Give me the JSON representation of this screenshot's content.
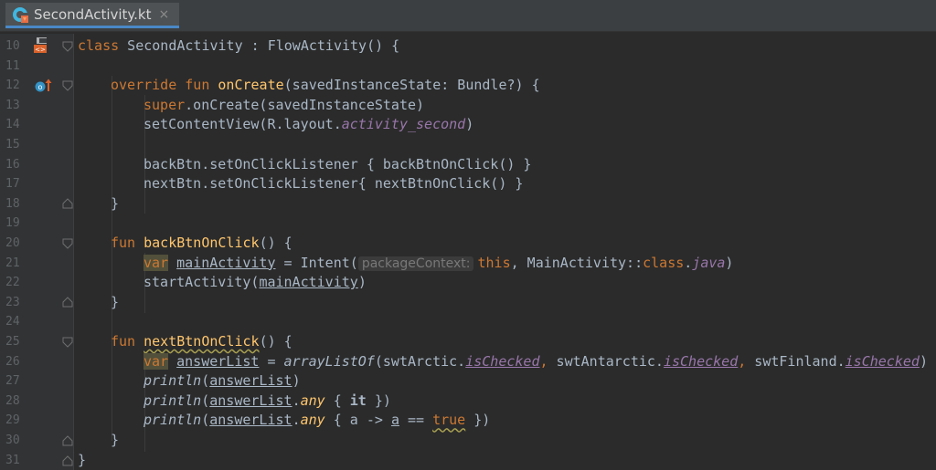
{
  "tab": {
    "title": "SecondActivity.kt",
    "close": "×"
  },
  "line_numbers": [
    "10",
    "11",
    "12",
    "13",
    "14",
    "15",
    "16",
    "17",
    "18",
    "19",
    "20",
    "21",
    "22",
    "23",
    "24",
    "25",
    "26",
    "27",
    "28",
    "29",
    "30",
    "31"
  ],
  "code": {
    "l10": {
      "kw": "class",
      "rest": " SecondActivity : FlowActivity() {"
    },
    "l12": {
      "kw": "override fun",
      "fn": "onCreate",
      "rest": "(savedInstanceState: Bundle?) {"
    },
    "l13": {
      "kw": "super",
      "rest": ".onCreate(savedInstanceState)"
    },
    "l14": {
      "pre": "setContentView(R.layout.",
      "prop": "activity_second",
      "post": ")"
    },
    "l16": {
      "text": "backBtn.setOnClickListener { backBtnOnClick() }"
    },
    "l17": {
      "text": "nextBtn.setOnClickListener{ nextBtnOnClick() }"
    },
    "l18": {
      "text": "}"
    },
    "l20": {
      "kw": "fun",
      "fn": "backBtnOnClick",
      "rest": "() {"
    },
    "l21": {
      "kw": "var",
      "var": "mainActivity",
      "mid": " = Intent(",
      "hint": "packageContext:",
      "this": "this",
      "comma": ", MainActivity::",
      "cls": "class",
      "dot": ".",
      "java": "java",
      "end": ")"
    },
    "l22": {
      "pre": "startActivity(",
      "arg": "mainActivity",
      "post": ")"
    },
    "l23": {
      "text": "}"
    },
    "l25": {
      "kw": "fun",
      "fn": "nextBtnOnClick",
      "rest": "() {"
    },
    "l26": {
      "kw": "var",
      "var": "answerList",
      "eq": " = ",
      "call": "arrayListOf",
      "a1": "(swtArctic.",
      "p1": "isChecked",
      "c1": ",",
      "a2": " swtAntarctic.",
      "p2": "isChecked",
      "c2": ",",
      "a3": " swtFinland.",
      "p3": "isChecked",
      "end": ")"
    },
    "l27": {
      "fn": "println",
      "o": "(",
      "arg": "answerList",
      "c": ")"
    },
    "l28": {
      "fn": "println",
      "o": "(",
      "arg": "answerList",
      "dot": ".",
      "any": "any",
      "rest": " { ",
      "it": "it",
      "end": " })"
    },
    "l29": {
      "fn": "println",
      "o": "(",
      "arg": "answerList",
      "dot": ".",
      "any": "any",
      "rest": " { a -> ",
      "a": "a",
      "eq": " == ",
      "tr": "true",
      "end": " })"
    },
    "l30": {
      "text": "}"
    },
    "l31": {
      "text": "}"
    }
  },
  "colors": {
    "background": "#2b2b2b",
    "keyword": "#cc7832",
    "function": "#ffc66d",
    "property": "#9876aa",
    "text": "#a9b7c6",
    "gutter": "#313335",
    "tab_accent": "#4a88c7"
  },
  "gutter_icons": [
    "layout-file-icon",
    "override-method-icon"
  ]
}
